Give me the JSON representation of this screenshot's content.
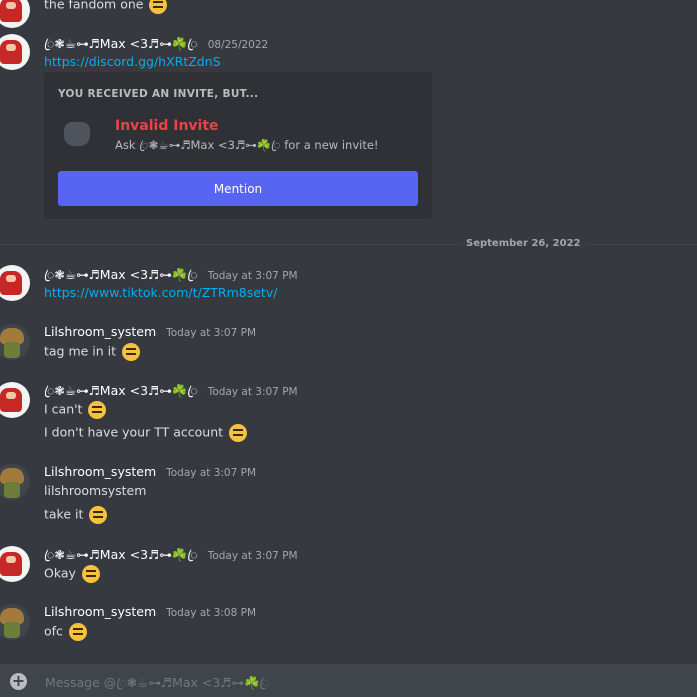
{
  "messages": {
    "top_partial": "the fandom one",
    "m1": {
      "author": "ꦿ❃☕︎⊶♬Max <3♬⊶☘️ꦿ",
      "time": "08/25/2022",
      "link": "https://discord.gg/hXRtZdnS"
    },
    "embed": {
      "title": "YOU RECEIVED AN INVITE, BUT...",
      "invalid": "Invalid Invite",
      "ask_prefix": "Ask",
      "ask_name": "ꦿ❃☕︎⊶♬Max <3♬⊶☘️ꦿ",
      "ask_suffix": "for a new invite!",
      "button": "Mention"
    },
    "date_divider": "September 26, 2022",
    "m2": {
      "author": "ꦿ❃☕︎⊶♬Max <3♬⊶☘️ꦿ",
      "time": "Today at 3:07 PM",
      "link": "https://www.tiktok.com/t/ZTRm8setv/"
    },
    "m3": {
      "author": "Lilshroom_system",
      "time": "Today at 3:07 PM",
      "line1": "tag me in it"
    },
    "m4": {
      "author": "ꦿ❃☕︎⊶♬Max <3♬⊶☘️ꦿ",
      "time": "Today at 3:07 PM",
      "line1": "I can't",
      "line2": "I don't have your TT account"
    },
    "m5": {
      "author": "Lilshroom_system",
      "time": "Today at 3:07 PM",
      "line1": "lilshroomsystem",
      "line2": "take it"
    },
    "m6": {
      "author": "ꦿ❃☕︎⊶♬Max <3♬⊶☘️ꦿ",
      "time": "Today at 3:07 PM",
      "line1": "Okay"
    },
    "m7": {
      "author": "Lilshroom_system",
      "time": "Today at 3:08 PM",
      "line1": "ofc"
    }
  },
  "composer": {
    "placeholder": "Message @ꦿ❃☕︎⊶♬Max <3♬⊶☘️ꦿ"
  },
  "colors": {
    "background": "#36393f",
    "accent": "#5865f2",
    "link": "#00aff4",
    "error": "#ed4245"
  }
}
